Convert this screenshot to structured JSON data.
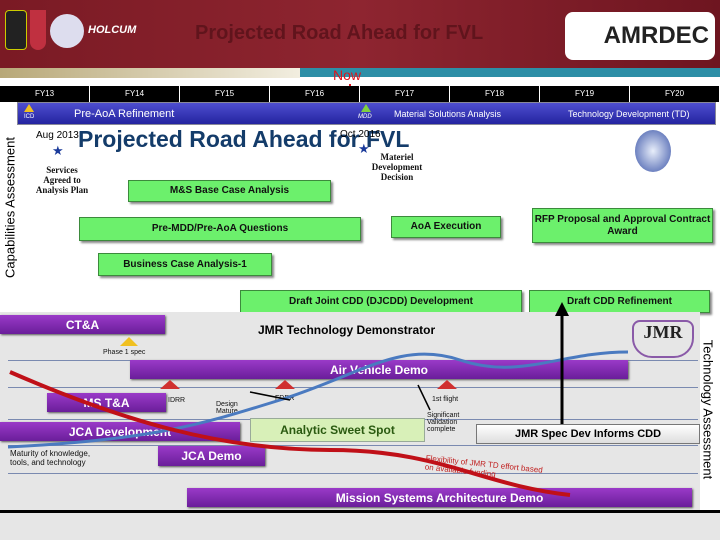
{
  "header": {
    "title": "Projected Road Ahead for FVL",
    "logo_text": "HOLCUM",
    "logo_amrdec": "AMRDEC"
  },
  "now_label": "Now",
  "fiscal_years": [
    "FY13",
    "FY14",
    "FY15",
    "FY16",
    "FY17",
    "FY18",
    "FY19",
    "FY20"
  ],
  "phase_band": {
    "icd": "ICD",
    "pre_aoa": "Pre-AoA Refinement",
    "mdd": "MDD",
    "msa": "Material Solutions Analysis",
    "td": "Technology Development (TD)"
  },
  "side_left": "Capabilities Assessment",
  "side_right": "Technology Assessment",
  "slide_title": "Projected Road Ahead for FVL",
  "milestones": {
    "aug": "Aug 2013",
    "aug_note": "Services Agreed to Analysis Plan",
    "oct": "Oct 2016",
    "oct_note": "Materiel Development Decision"
  },
  "green_boxes": {
    "ms_base": "M&S Base Case Analysis",
    "pre_mdd": "Pre-MDD/Pre-AoA Questions",
    "business": "Business Case Analysis-1",
    "djcdd": "Draft Joint CDD (DJCDD) Development",
    "draft_cdd": "Draft CDD Refinement",
    "aoa": "AoA Execution",
    "rfp": "RFP Proposal and Approval Contract Award"
  },
  "tech": {
    "ctna": "CT&A",
    "jmr_title": "JMR Technology Demonstrator",
    "phase1": "Phase 1 spec",
    "avd": "Air Vehicle Demo",
    "mst": "MS T&A",
    "idrr": "IDRR",
    "fdrr": "FDRR",
    "first_flight": "1st flight",
    "design_mature": "Design Mature",
    "sig_val": "Significant Validation complete",
    "jca_dev": "JCA Development",
    "sweet": "Analytic Sweet Spot",
    "jmr_spec": "JMR Spec Dev Informs CDD",
    "maturity": "Maturity of knowledge, tools, and technology",
    "jca_demo": "JCA Demo",
    "flex": "Flexibility of JMR TD effort based on available funding",
    "msa_demo": "Mission Systems Architecture Demo",
    "jmr_logo": "JMR"
  },
  "colors": {
    "header": "#7a1a24",
    "green": "#6cf06c",
    "purple": "#7a2aaa",
    "band": "#3434b4",
    "now": "#e0141c"
  }
}
